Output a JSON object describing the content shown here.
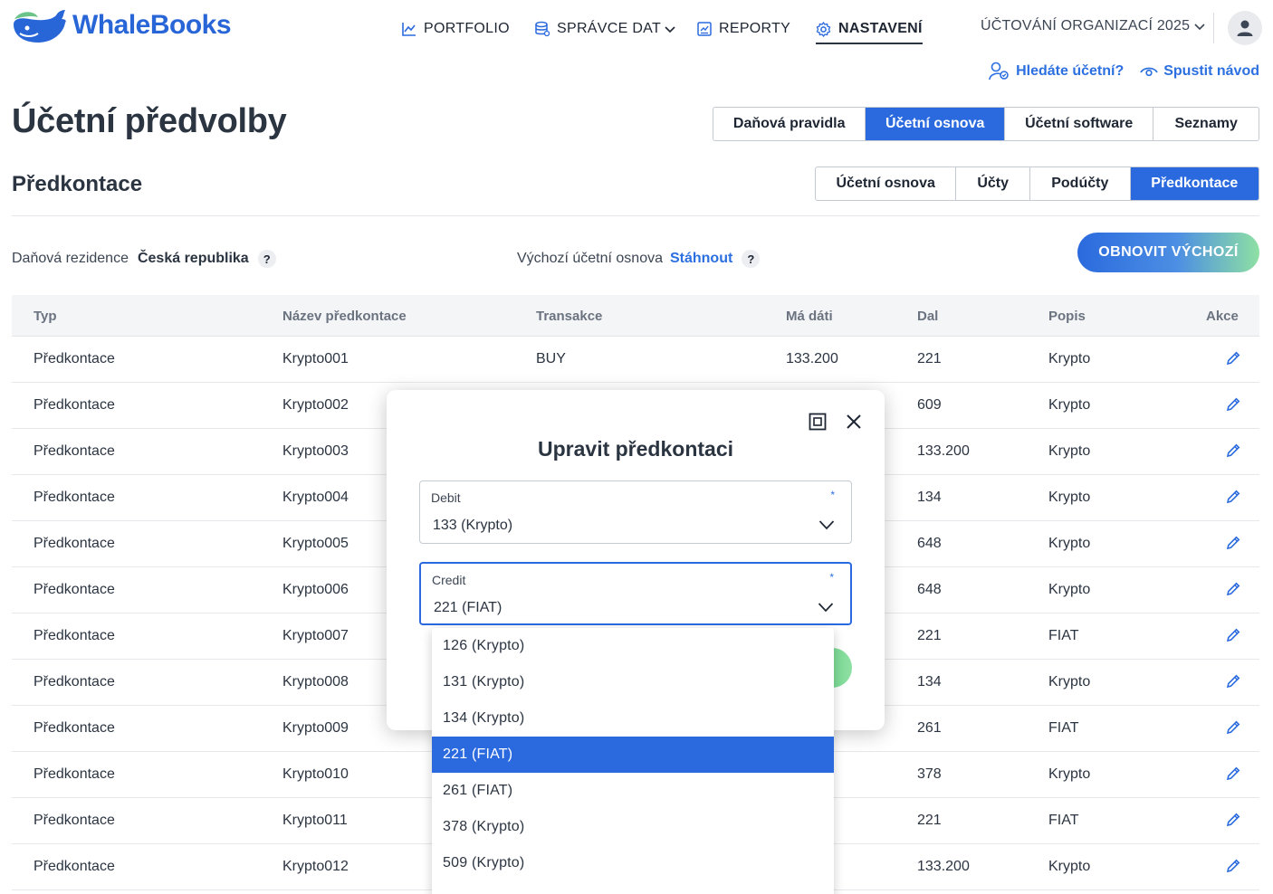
{
  "app": {
    "logo_text": "WhaleBooks"
  },
  "nav": {
    "portfolio": "PORTFOLIO",
    "data_manager": "SPRÁVCE DAT",
    "reports": "REPORTY",
    "settings": "NASTAVENÍ",
    "organization": "ÚČTOVÁNÍ ORGANIZACÍ 2025"
  },
  "helpers": {
    "find_accountant": "Hledáte účetní?",
    "start_guide": "Spustit návod"
  },
  "page": {
    "title": "Účetní předvolby",
    "section_title": "Předkontace"
  },
  "main_tabs": [
    "Daňová pravidla",
    "Účetní osnova",
    "Účetní software",
    "Seznamy"
  ],
  "main_tabs_active": "Účetní osnova",
  "sub_tabs": [
    "Účetní osnova",
    "Účty",
    "Podúčty",
    "Předkontace"
  ],
  "sub_tabs_active": "Předkontace",
  "info": {
    "tax_residence_label": "Daňová rezidence",
    "tax_residence_value": "Česká republika",
    "default_chart_label": "Výchozí účetní osnova",
    "download_link": "Stáhnout",
    "help_mark": "?",
    "reset_button": "OBNOVIT VÝCHOZÍ"
  },
  "table": {
    "headers": {
      "type": "Typ",
      "name": "Název předkontace",
      "transaction": "Transakce",
      "debit": "Má dáti",
      "credit": "Dal",
      "description": "Popis",
      "actions": "Akce"
    },
    "rows": [
      {
        "type": "Předkontace",
        "name": "Krypto001",
        "transaction": "BUY",
        "debit": "133.200",
        "credit": "221",
        "description": "Krypto"
      },
      {
        "type": "Předkontace",
        "name": "Krypto002",
        "transaction": "",
        "debit": "",
        "credit": "609",
        "description": "Krypto"
      },
      {
        "type": "Předkontace",
        "name": "Krypto003",
        "transaction": "",
        "debit": "",
        "credit": "133.200",
        "description": "Krypto"
      },
      {
        "type": "Předkontace",
        "name": "Krypto004",
        "transaction": "",
        "debit": "",
        "credit": "134",
        "description": "Krypto"
      },
      {
        "type": "Předkontace",
        "name": "Krypto005",
        "transaction": "",
        "debit": "",
        "credit": "648",
        "description": "Krypto"
      },
      {
        "type": "Předkontace",
        "name": "Krypto006",
        "transaction": "",
        "debit": "",
        "credit": "648",
        "description": "Krypto"
      },
      {
        "type": "Předkontace",
        "name": "Krypto007",
        "transaction": "",
        "debit": "",
        "credit": "221",
        "description": "FIAT"
      },
      {
        "type": "Předkontace",
        "name": "Krypto008",
        "transaction": "",
        "debit": "",
        "credit": "134",
        "description": "Krypto"
      },
      {
        "type": "Předkontace",
        "name": "Krypto009",
        "transaction": "",
        "debit": "",
        "credit": "261",
        "description": "FIAT"
      },
      {
        "type": "Předkontace",
        "name": "Krypto010",
        "transaction": "",
        "debit": "",
        "credit": "378",
        "description": "Krypto"
      },
      {
        "type": "Předkontace",
        "name": "Krypto011",
        "transaction": "",
        "debit": "",
        "credit": "221",
        "description": "FIAT"
      },
      {
        "type": "Předkontace",
        "name": "Krypto012",
        "transaction": "",
        "debit": "",
        "credit": "133.200",
        "description": "Krypto"
      }
    ]
  },
  "modal": {
    "title": "Upravit předkontaci",
    "debit_label": "Debit",
    "debit_value": "133 (Krypto)",
    "credit_label": "Credit",
    "credit_value": "221 (FIAT)",
    "required_mark": "*"
  },
  "dropdown": {
    "options": [
      "126 (Krypto)",
      "131 (Krypto)",
      "134 (Krypto)",
      "221 (FIAT)",
      "261 (FIAT)",
      "378 (Krypto)",
      "509 (Krypto)"
    ],
    "selected": "221 (FIAT)"
  },
  "colors": {
    "accent": "#2a6ade",
    "link": "#2b6fe0",
    "text": "#2b3441",
    "green": "#8ee0a3"
  }
}
